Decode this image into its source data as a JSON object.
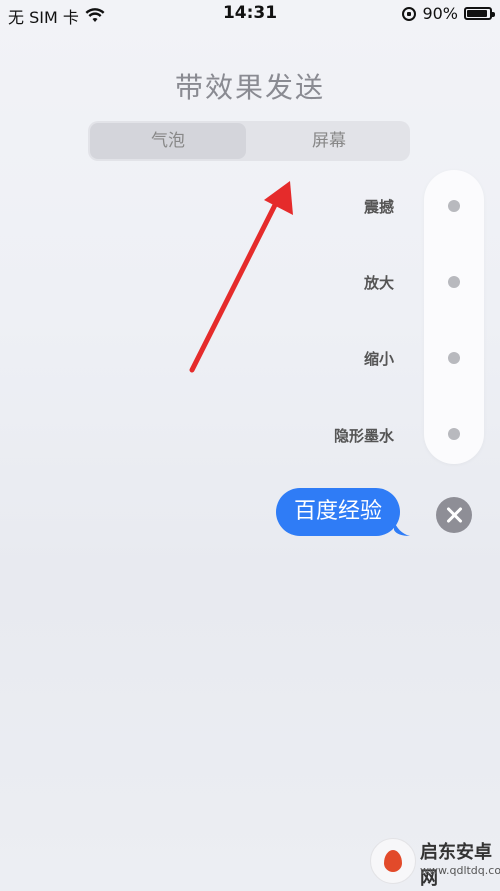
{
  "status_bar": {
    "carrier": "无 SIM 卡",
    "time": "14:31",
    "battery": "90%",
    "battery_level": 0.9
  },
  "header": {
    "title": "带效果发送"
  },
  "segmented": {
    "tabs": [
      {
        "label": "气泡",
        "selected": true
      },
      {
        "label": "屏幕",
        "selected": false
      }
    ]
  },
  "effects": {
    "items": [
      {
        "label": "震撼"
      },
      {
        "label": "放大"
      },
      {
        "label": "缩小"
      },
      {
        "label": "隐形墨水"
      }
    ]
  },
  "message": {
    "text": "百度经验"
  },
  "watermark": {
    "name": "启东安卓网",
    "url": "www.qdltdq.com"
  },
  "colors": {
    "bubble": "#2f7cf6",
    "annotation_arrow": "#e52b2b"
  }
}
